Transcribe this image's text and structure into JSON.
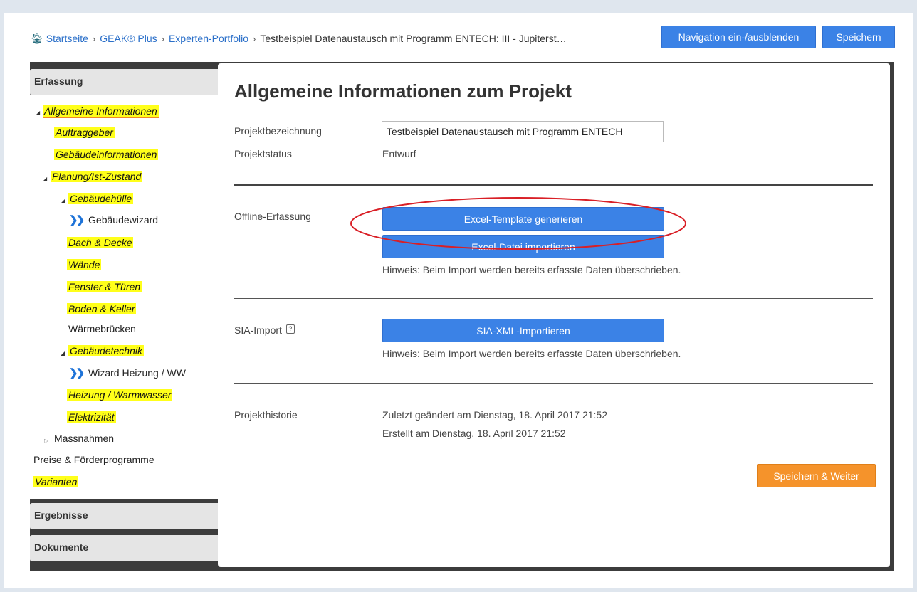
{
  "breadcrumb": {
    "items": [
      "Startseite",
      "GEAK® Plus",
      "Experten-Portfolio"
    ],
    "current": "Testbeispiel Datenaustausch mit Programm ENTECH: III - Jupiterst…"
  },
  "toolbar": {
    "nav_toggle_label": "Navigation ein-/ausblenden",
    "save_label": "Speichern"
  },
  "sidebar": {
    "sections": {
      "erfassung": "Erfassung",
      "ergebnisse": "Ergebnisse",
      "dokumente": "Dokumente"
    },
    "items": [
      "Allgemeine Informationen",
      "Auftraggeber",
      "Gebäudeinformationen",
      "Planung/Ist-Zustand",
      "Gebäudehülle",
      "Gebäudewizard",
      "Dach & Decke",
      "Wände",
      "Fenster & Türen",
      "Boden & Keller",
      "Wärmebrücken",
      "Gebäudetechnik",
      "Wizard Heizung / WW",
      "Heizung / Warmwasser",
      "Elektrizität",
      "Massnahmen",
      "Preise & Förderprogramme",
      "Varianten"
    ]
  },
  "main": {
    "title": "Allgemeine Informationen zum Projekt",
    "projektbezeichnung_label": "Projektbezeichnung",
    "projektbezeichnung_value": "Testbeispiel Datenaustausch mit Programm ENTECH",
    "projektstatus_label": "Projektstatus",
    "projektstatus_value": "Entwurf",
    "offline_label": "Offline-Erfassung",
    "excel_template_button": "Excel-Template generieren",
    "excel_import_button": "Excel-Datei importieren",
    "import_note": "Hinweis: Beim Import werden bereits erfasste Daten überschrieben.",
    "sia_label": "SIA-Import",
    "sia_button": "SIA-XML-Importieren",
    "sia_note": "Hinweis: Beim Import werden bereits erfasste Daten überschrieben.",
    "history_label": "Projekthistorie",
    "history_changed": "Zuletzt geändert am Dienstag, 18. April 2017 21:52",
    "history_created": "Erstellt am Dienstag, 18. April 2017 21:52",
    "save_next_button": "Speichern & Weiter"
  },
  "colors": {
    "accent_blue": "#3b82e6",
    "highlight_yellow": "#ffff1a",
    "orange": "#f5932b",
    "annotation_red": "#d91f26"
  }
}
